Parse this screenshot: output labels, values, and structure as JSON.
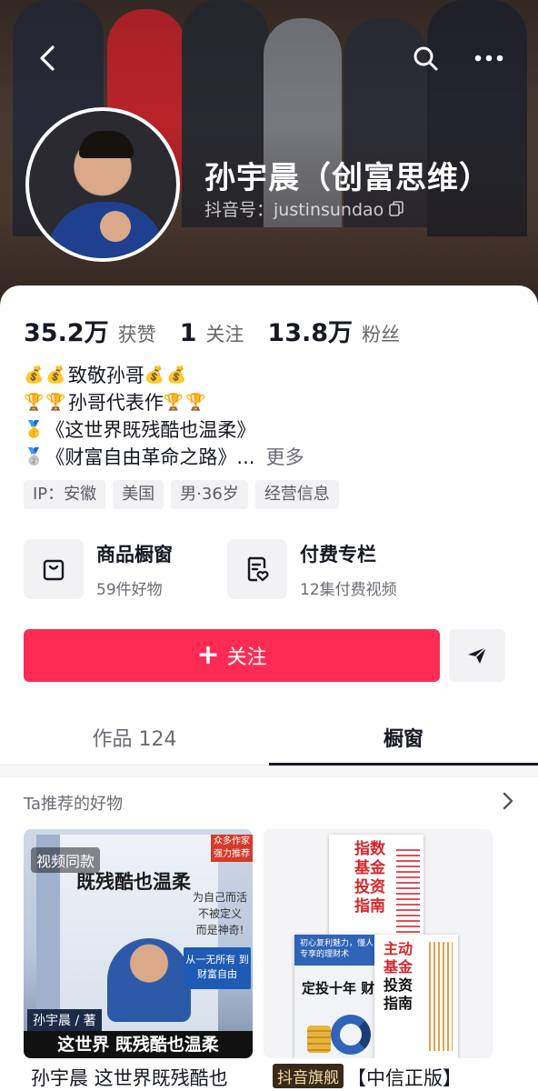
{
  "profile": {
    "name": "孙宇晨（创富思维）",
    "douyin_id": "抖音号：justinsundao"
  },
  "stats": [
    {
      "value": "35.2万",
      "label": "获赞"
    },
    {
      "value": "1",
      "label": "关注"
    },
    {
      "value": "13.8万",
      "label": "粉丝"
    }
  ],
  "bio": {
    "line1": "致敬孙哥",
    "line2": "孙哥代表作",
    "line3": "《这世界既残酷也温柔》",
    "line4": "《财富自由革命之路》...",
    "more": "更多",
    "emoji_money": "💰",
    "emoji_trophy": "🏆",
    "emoji_gold": "🥇",
    "emoji_silver": "🥈"
  },
  "tags": [
    "IP：安徽",
    "美国",
    "男·36岁",
    "经营信息"
  ],
  "services": [
    {
      "title": "商品橱窗",
      "subtitle": "59件好物",
      "icon": "shopping-bag-icon"
    },
    {
      "title": "付费专栏",
      "subtitle": "12集付费视频",
      "icon": "paid-column-icon"
    }
  ],
  "actions": {
    "follow_label": "关注",
    "follow_plus": "+",
    "follow_color": "#fe2c55"
  },
  "tabs": {
    "works": "作品 124",
    "shop": "橱窗"
  },
  "recommend": {
    "title": "Ta推荐的好物"
  },
  "products": [
    {
      "title": "孙宇晨 这世界既残酷也",
      "video_tag": "视频同款",
      "cover_headline": "既残酷也温柔",
      "corner": "众多作家强力推荐",
      "script": "为自己而活 不被定义 而是神奇!",
      "callout": "从一无所有 到财富自由",
      "author": "孙宇晨 / 著",
      "bottom": "这世界 既残酷也温柔"
    },
    {
      "badge": "抖音旗舰",
      "title": "【中信正版】",
      "book_a": "指数基金投资指南",
      "book_b_top": "初心复利魅力，懂人专享的理财术",
      "book_b": "定投十年 财务自由",
      "book_c_red": "主动基金",
      "book_c": "投资指南"
    }
  ]
}
